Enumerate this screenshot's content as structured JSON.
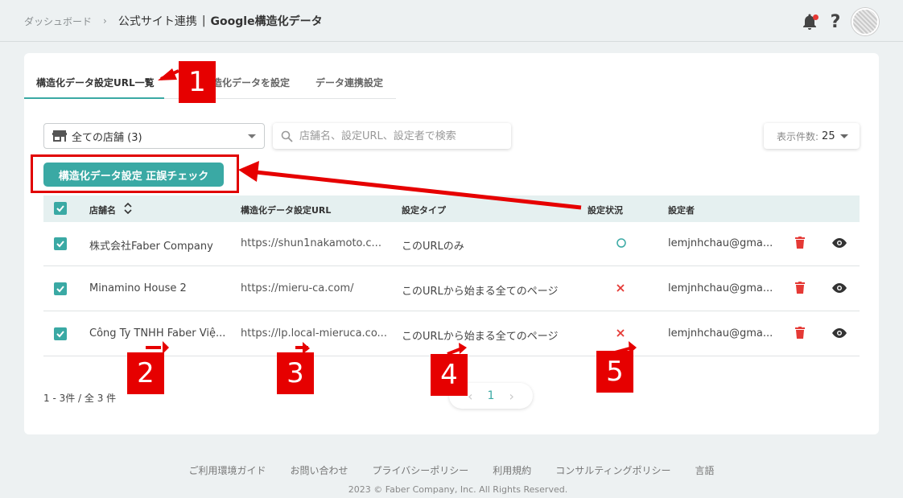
{
  "breadcrumb": {
    "home": "ダッシュボード",
    "separator": "›",
    "section": "公式サイト連携",
    "divider": "|",
    "current": "Google構造化データ"
  },
  "header": {
    "notification_icon": "bell-icon",
    "help_icon": "question-icon",
    "help_glyph": "?"
  },
  "tabs": [
    {
      "label": "構造化データ設定URL一覧",
      "active": true
    },
    {
      "label": "構造化データを設定",
      "visible_part": "造化データを設定",
      "active": false
    },
    {
      "label": "データ連携設定",
      "active": false
    }
  ],
  "filters": {
    "store_select": "全ての店舗 (3)",
    "search_placeholder": "店舗名、設定URL、設定者で検索",
    "per_page_label": "表示件数:",
    "per_page_value": "25"
  },
  "check_button": "構造化データ設定 正誤チェック",
  "table": {
    "headers": {
      "store": "店舗名",
      "url": "構造化データ設定URL",
      "type": "設定タイプ",
      "status": "設定状況",
      "setter": "設定者"
    },
    "rows": [
      {
        "store": "株式会社Faber Company",
        "url": "https://shun1nakamoto.c...",
        "type": "このURLのみ",
        "status": "ok",
        "setter": "lemjnhchau@gma..."
      },
      {
        "store": "Minamino House 2",
        "url": "https://mieru-ca.com/",
        "type": "このURLから始まる全てのページ",
        "status": "ng",
        "setter": "lemjnhchau@gma..."
      },
      {
        "store": "Công Ty TNHH Faber Việ...",
        "url": "https://lp.local-mieruca.co...",
        "type": "このURLから始まる全てのページ",
        "status": "ng",
        "setter": "lemjnhchau@gma..."
      }
    ]
  },
  "pagination": {
    "summary": "1 - 3件 / 全 3 件",
    "prev": "‹",
    "page": "1",
    "next": "›"
  },
  "footer": {
    "links": [
      "ご利用環境ガイド",
      "お問い合わせ",
      "プライバシーポリシー",
      "利用規約",
      "コンサルティングポリシー",
      "言語"
    ],
    "copyright": "2023 © Faber Company, Inc. All Rights Reserved."
  },
  "annotations": {
    "m1": "1",
    "m2": "2",
    "m3": "3",
    "m4": "4",
    "m5": "5"
  },
  "colors": {
    "accent": "#3aa9a4",
    "annotation": "#e60000",
    "delete": "#e53935",
    "status_ok": "#3aa9a4",
    "status_ng": "#e53935"
  }
}
